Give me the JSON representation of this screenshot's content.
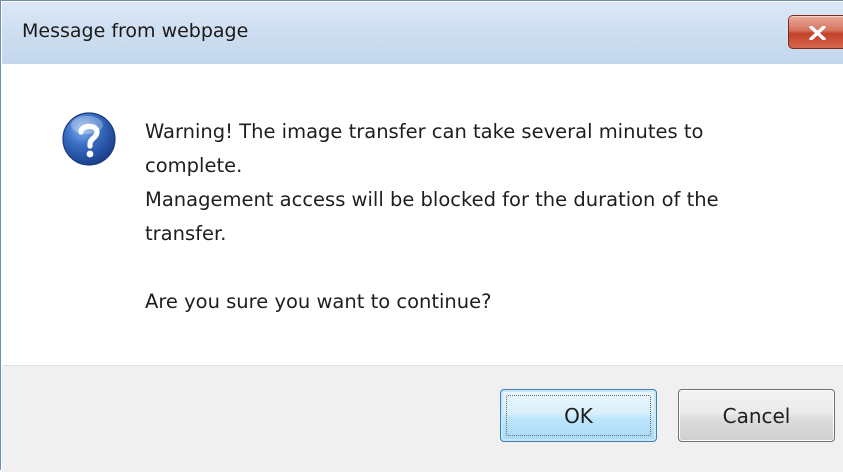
{
  "window": {
    "title": "Message from webpage",
    "close_icon": "close-x-icon"
  },
  "message": {
    "icon": "question-mark-icon",
    "lines": [
      "Warning! The image transfer can take several minutes to",
      "complete.",
      "Management access will be blocked for the duration of the",
      "transfer.",
      "",
      "Are you sure you want to continue?"
    ]
  },
  "buttons": {
    "ok_label": "OK",
    "cancel_label": "Cancel"
  },
  "colors": {
    "titlebar": "#cfdff1",
    "close_button": "#c2422b",
    "footer": "#f0f0f0",
    "ok_button_border": "#3c7fb1",
    "question_icon": "#2456a8"
  }
}
